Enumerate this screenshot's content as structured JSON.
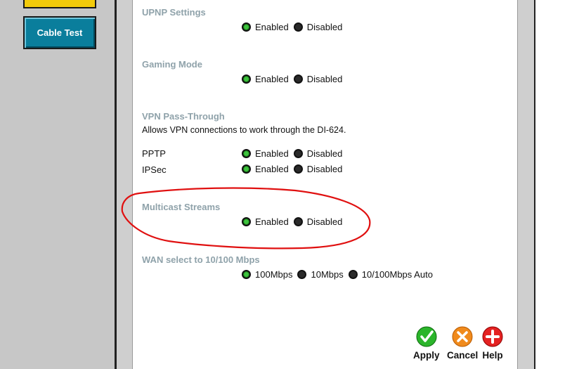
{
  "nav": {
    "cable_test": "Cable Test"
  },
  "sections": {
    "upnp": {
      "title": "UPNP Settings",
      "enabled": "Enabled",
      "disabled": "Disabled"
    },
    "gaming": {
      "title": "Gaming Mode",
      "enabled": "Enabled",
      "disabled": "Disabled"
    },
    "vpn": {
      "title": "VPN Pass-Through",
      "description": "Allows VPN connections to work through the DI-624.",
      "pptp": {
        "label": "PPTP",
        "enabled": "Enabled",
        "disabled": "Disabled"
      },
      "ipsec": {
        "label": "IPSec",
        "enabled": "Enabled",
        "disabled": "Disabled"
      }
    },
    "multicast": {
      "title": "Multicast Streams",
      "enabled": "Enabled",
      "disabled": "Disabled"
    },
    "wan": {
      "title": "WAN select to 10/100 Mbps",
      "opt100": "100Mbps",
      "opt10": "10Mbps",
      "optauto": "10/100Mbps Auto"
    }
  },
  "actions": {
    "apply": "Apply",
    "cancel": "Cancel",
    "help": "Help"
  },
  "colors": {
    "section_title": "#8fa2aa",
    "highlight": "#e01010",
    "nav_button": "#0a7e9c"
  }
}
